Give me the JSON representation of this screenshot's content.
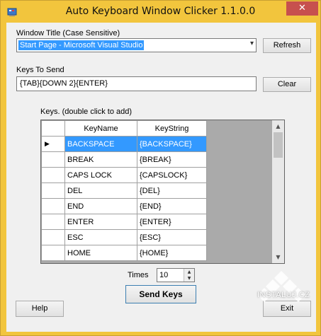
{
  "window": {
    "title": "Auto Keyboard Window Clicker 1.1.0.0"
  },
  "titlebar": {
    "min": "–",
    "max": "☐",
    "close": "✕"
  },
  "window_title_section": {
    "label": "Window Title (Case Sensitive)",
    "selected": "Start Page - Microsoft Visual Studio",
    "refresh": "Refresh"
  },
  "keys_section": {
    "label": "Keys To Send",
    "value": "{TAB}{DOWN 2}{ENTER}",
    "clear": "Clear"
  },
  "grid": {
    "caption": "Keys. (double click to add)",
    "columns": [
      "KeyName",
      "KeyString"
    ],
    "rows": [
      [
        "BACKSPACE",
        "{BACKSPACE}"
      ],
      [
        "BREAK",
        "{BREAK}"
      ],
      [
        "CAPS LOCK",
        "{CAPSLOCK}"
      ],
      [
        "DEL",
        "{DEL}"
      ],
      [
        "END",
        "{END}"
      ],
      [
        "ENTER",
        "{ENTER}"
      ],
      [
        "ESC",
        "{ESC}"
      ],
      [
        "HOME",
        "{HOME}"
      ]
    ]
  },
  "times": {
    "label": "Times",
    "value": "10"
  },
  "buttons": {
    "send": "Send Keys",
    "help": "Help",
    "exit": "Exit"
  },
  "watermark": {
    "text": "INSTALUJ.CZ"
  },
  "colors": {
    "frame": "#f2c53d",
    "selection": "#3399ff",
    "close": "#c7504e"
  }
}
